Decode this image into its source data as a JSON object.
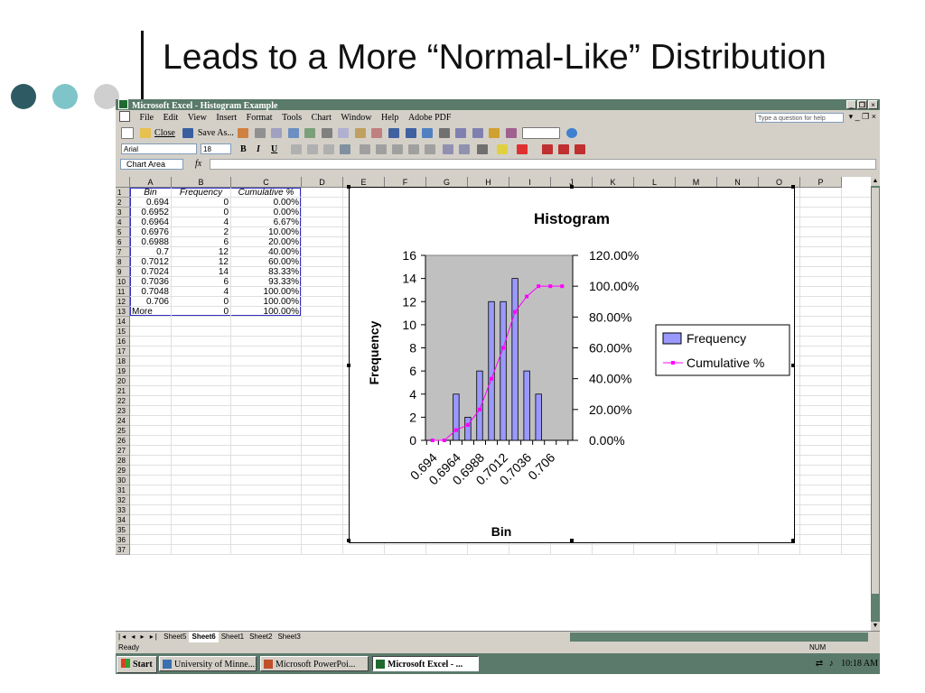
{
  "slide": {
    "title": "Leads to a More “Normal-Like” Distribution",
    "dot_colors": [
      "#2e5b63",
      "#7fc4c8",
      "#cfcfcf"
    ]
  },
  "excel": {
    "window_title": "Microsoft Excel - Histogram Example",
    "window_buttons": [
      "_",
      "❐",
      "×"
    ],
    "menu": [
      "File",
      "Edit",
      "View",
      "Insert",
      "Format",
      "Tools",
      "Chart",
      "Window",
      "Help",
      "Adobe PDF"
    ],
    "help_placeholder": "Type a question for help",
    "toolbar_labels": {
      "close": "Close",
      "save_as": "Save As..."
    },
    "font_name": "Arial",
    "font_size": "18",
    "format_buttons": [
      "B",
      "I",
      "U"
    ],
    "name_box": "Chart Area",
    "fx_label": "fx",
    "columns": [
      "A",
      "B",
      "C",
      "D",
      "E",
      "F",
      "G",
      "H",
      "I",
      "J",
      "K",
      "L",
      "M",
      "N",
      "O",
      "P"
    ],
    "rows_visible": 37,
    "header_row": {
      "bin": "Bin",
      "frequency": "Frequency",
      "cumulative": "Cumulative %"
    },
    "table": [
      {
        "bin": "0.694",
        "frequency": "0",
        "cumulative": "0.00%"
      },
      {
        "bin": "0.6952",
        "frequency": "0",
        "cumulative": "0.00%"
      },
      {
        "bin": "0.6964",
        "frequency": "4",
        "cumulative": "6.67%"
      },
      {
        "bin": "0.6976",
        "frequency": "2",
        "cumulative": "10.00%"
      },
      {
        "bin": "0.6988",
        "frequency": "6",
        "cumulative": "20.00%"
      },
      {
        "bin": "0.7",
        "frequency": "12",
        "cumulative": "40.00%"
      },
      {
        "bin": "0.7012",
        "frequency": "12",
        "cumulative": "60.00%"
      },
      {
        "bin": "0.7024",
        "frequency": "14",
        "cumulative": "83.33%"
      },
      {
        "bin": "0.7036",
        "frequency": "6",
        "cumulative": "93.33%"
      },
      {
        "bin": "0.7048",
        "frequency": "4",
        "cumulative": "100.00%"
      },
      {
        "bin": "0.706",
        "frequency": "0",
        "cumulative": "100.00%"
      },
      {
        "bin": "More",
        "frequency": "0",
        "cumulative": "100.00%"
      }
    ],
    "sheet_tabs": [
      {
        "label": "Sheet5",
        "active": false
      },
      {
        "label": "Sheet6",
        "active": true
      },
      {
        "label": "Sheet1",
        "active": false
      },
      {
        "label": "Sheet2",
        "active": false
      },
      {
        "label": "Sheet3",
        "active": false
      }
    ],
    "status": {
      "ready": "Ready",
      "num": "NUM"
    },
    "taskbar": {
      "start": "Start",
      "tasks": [
        {
          "label": "University of Minne...",
          "icon_color": "#3a6fb0",
          "active": false
        },
        {
          "label": "Microsoft PowerPoi...",
          "icon_color": "#c0502a",
          "active": false
        },
        {
          "label": "Microsoft Excel - ...",
          "icon_color": "#1f6b2e",
          "active": true
        }
      ],
      "clock": "10:18 AM"
    }
  },
  "chart_data": {
    "type": "bar",
    "title": "Histogram",
    "xlabel": "Bin",
    "ylabel": "Frequency",
    "ylim": [
      0,
      16
    ],
    "yticks": [
      0,
      2,
      4,
      6,
      8,
      10,
      12,
      14,
      16
    ],
    "y2lim": [
      0,
      120
    ],
    "y2ticks": [
      "0.00%",
      "20.00%",
      "40.00%",
      "60.00%",
      "80.00%",
      "100.00%",
      "120.00%"
    ],
    "categories": [
      "0.694",
      "0.6952",
      "0.6964",
      "0.6976",
      "0.6988",
      "0.7",
      "0.7012",
      "0.7024",
      "0.7036",
      "0.7048",
      "0.706",
      "More"
    ],
    "x_tick_labels_shown": [
      "0.694",
      "0.6964",
      "0.6988",
      "0.7012",
      "0.7036",
      "0.706"
    ],
    "series": [
      {
        "name": "Frequency",
        "kind": "bar",
        "axis": "left",
        "color": "#9999ff",
        "values": [
          0,
          0,
          4,
          2,
          6,
          12,
          12,
          14,
          6,
          4,
          0,
          0
        ]
      },
      {
        "name": "Cumulative %",
        "kind": "line",
        "axis": "right",
        "color": "#ff00ff",
        "values": [
          0,
          0,
          6.67,
          10,
          20,
          40,
          60,
          83.33,
          93.33,
          100,
          100,
          100
        ]
      }
    ],
    "plot_background": "#c0c0c0",
    "legend_position": "right"
  }
}
